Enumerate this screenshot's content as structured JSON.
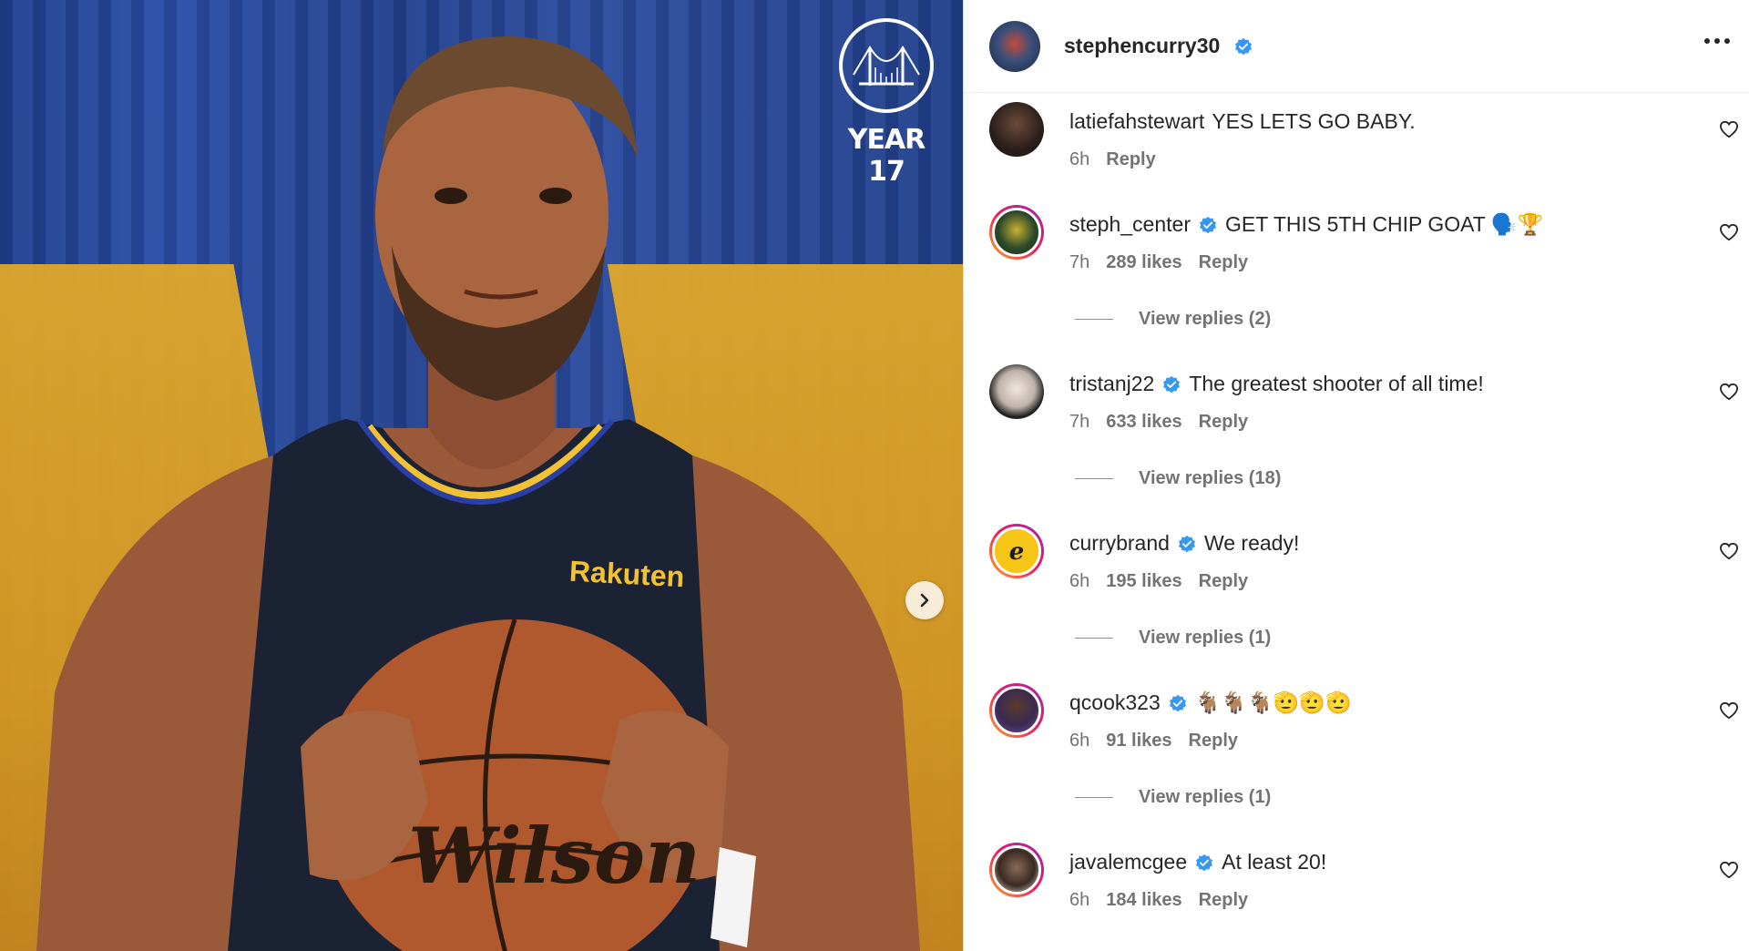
{
  "post": {
    "logo_text": "YEAR 17",
    "jersey_sponsor": "Rakuten",
    "ball_brand": "Wilson"
  },
  "header": {
    "username": "stephencurry30"
  },
  "comments": [
    {
      "username": "latiefahstewart",
      "text": "YES LETS GO BABY.",
      "time": "6h",
      "likes": "",
      "reply": "Reply",
      "verified": false,
      "view_replies": ""
    },
    {
      "username": "steph_center",
      "text": "GET THIS 5TH CHIP GOAT 🗣️🏆",
      "time": "7h",
      "likes": "289 likes",
      "reply": "Reply",
      "verified": true,
      "view_replies": "View replies (2)"
    },
    {
      "username": "tristanj22",
      "text": "The greatest shooter of all time!",
      "time": "7h",
      "likes": "633 likes",
      "reply": "Reply",
      "verified": true,
      "view_replies": "View replies (18)"
    },
    {
      "username": "currybrand",
      "text": "We ready!",
      "time": "6h",
      "likes": "195 likes",
      "reply": "Reply",
      "verified": true,
      "view_replies": "View replies (1)"
    },
    {
      "username": "qcook323",
      "text": "🐐🐐🐐🫡🫡🫡",
      "time": "6h",
      "likes": "91 likes",
      "reply": "Reply",
      "verified": true,
      "view_replies": "View replies (1)"
    },
    {
      "username": "javalemcgee",
      "text": "At least 20!",
      "time": "6h",
      "likes": "184 likes",
      "reply": "Reply",
      "verified": true,
      "view_replies": ""
    }
  ],
  "colors": {
    "verified_blue": "#3897f0",
    "text": "#262626",
    "meta": "#737373"
  }
}
